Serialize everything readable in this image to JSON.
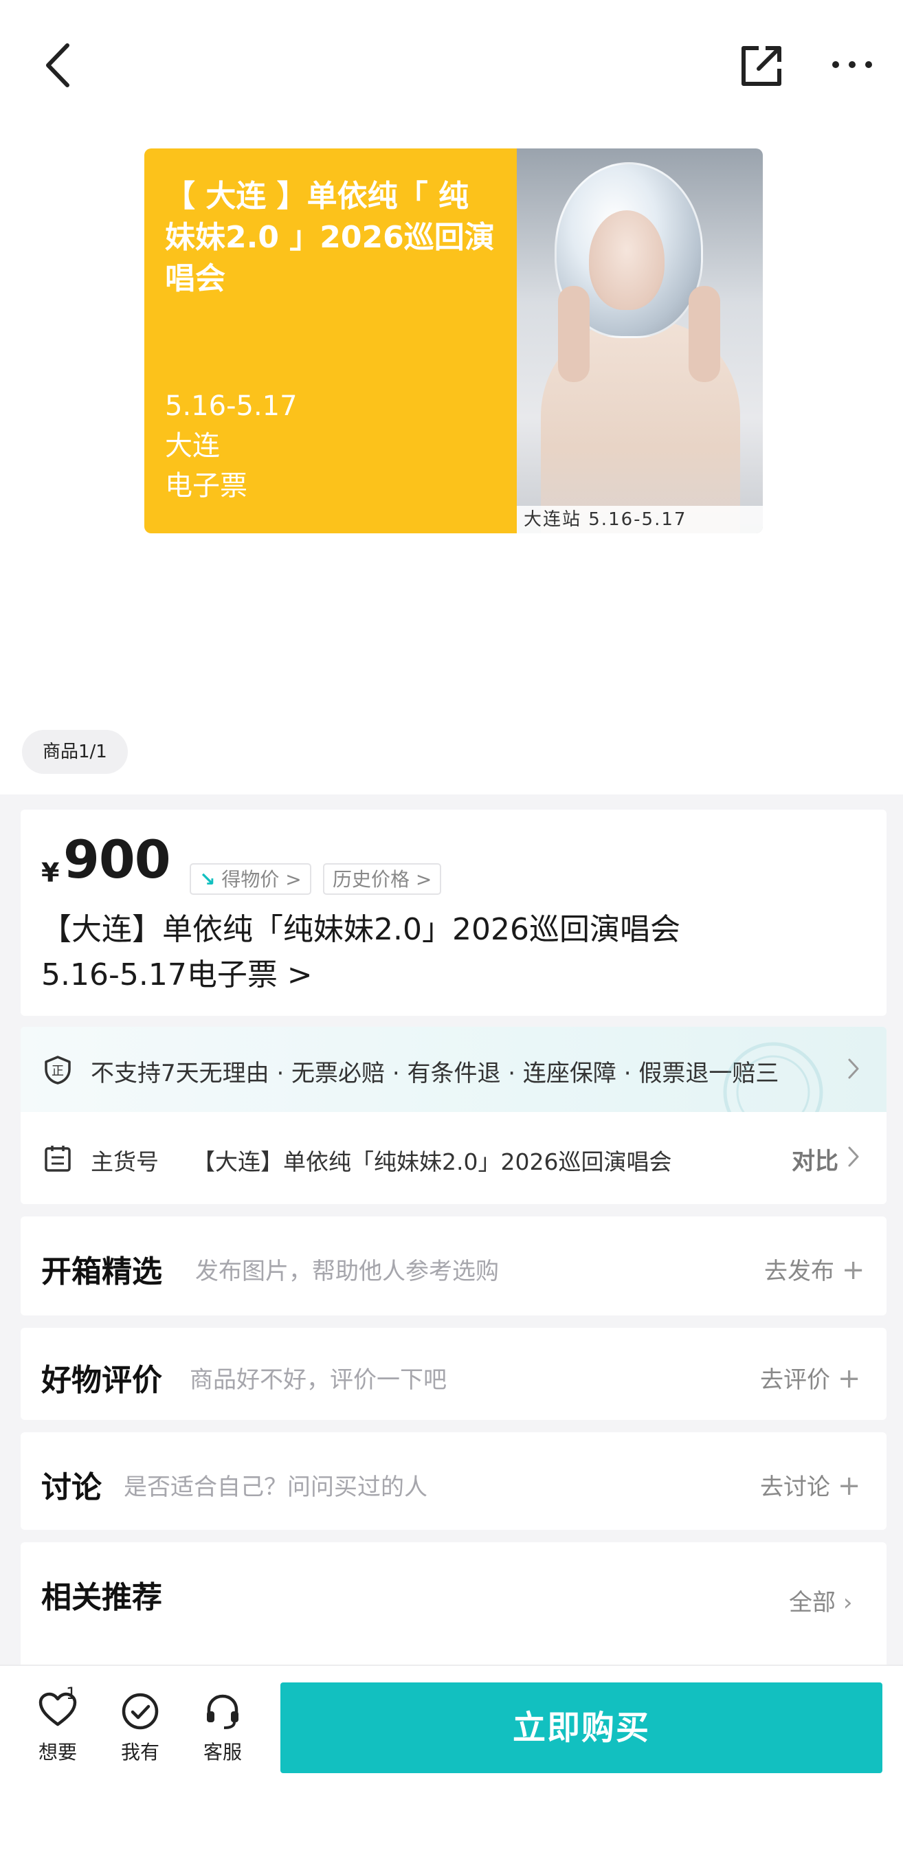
{
  "nav": {
    "back_icon": "chevron-left-icon",
    "share_icon": "share-icon",
    "more_icon": "more-dots-icon"
  },
  "poster": {
    "title": "【 大连 】单依纯「 纯妹妹2.0 」2026巡回演唱会",
    "dates": "5.16-5.17",
    "city": "大连",
    "ticket_type": "电子票",
    "image_caption": "大连站 5.16-5.17"
  },
  "image_counter": "商品1/1",
  "product": {
    "currency": "¥",
    "price": "900",
    "tag_dewu": "得物价 >",
    "tag_history": "历史价格 >",
    "title_line1": "【大连】单依纯「纯妹妹2.0」2026巡回演唱会",
    "title_line2": "5.16-5.17电子票 >"
  },
  "guarantee": {
    "text": "不支持7天无理由 · 无票必赔 · 有条件退 · 连座保障 · 假票退一赔三"
  },
  "main_item": {
    "label": "主货号",
    "value": "【大连】单依纯「纯妹妹2.0」2026巡回演唱会",
    "compare": "对比"
  },
  "unbox": {
    "title": "开箱精选",
    "hint": "发布图片，帮助他人参考选购",
    "action": "去发布"
  },
  "review": {
    "title": "好物评价",
    "hint": "商品好不好，评价一下吧",
    "action": "去评价"
  },
  "discuss": {
    "title": "讨论",
    "hint": "是否适合自己？问问买过的人",
    "action": "去讨论"
  },
  "related": {
    "title": "相关推荐",
    "action": "全部"
  },
  "bottom_bar": {
    "want_label": "想要",
    "want_count": "1",
    "have_label": "我有",
    "service_label": "客服",
    "buy_label": "立即购买"
  },
  "colors": {
    "accent": "#12c0c0",
    "poster_yellow": "#fcc21b"
  }
}
